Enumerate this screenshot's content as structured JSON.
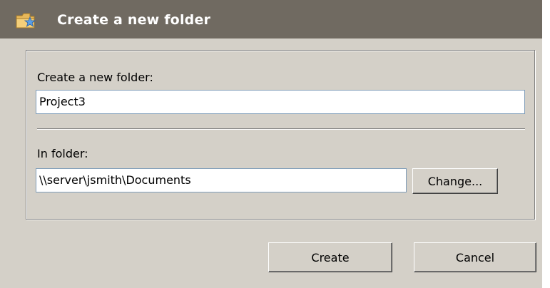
{
  "window": {
    "title": "Create a new folder",
    "icon": "folder-star-icon"
  },
  "new_folder": {
    "label": "Create a new folder:",
    "value": "Project3"
  },
  "in_folder": {
    "label": "In folder:",
    "value": "\\\\server\\jsmith\\Documents",
    "change_label": "Change..."
  },
  "buttons": {
    "create_label": "Create",
    "cancel_label": "Cancel"
  },
  "colors": {
    "titlebar": "#706a61",
    "dialog_bg": "#d4d0c8",
    "textbox_border": "#7f9db9"
  }
}
